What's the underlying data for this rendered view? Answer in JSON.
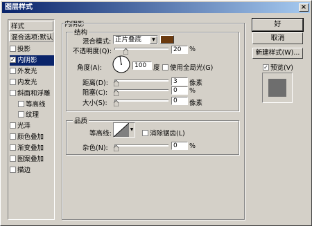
{
  "window": {
    "title": "图层样式",
    "close_glyph": "×"
  },
  "sidebar": {
    "header": "样式",
    "blend_options": "混合选项:默认",
    "items": [
      {
        "label": "投影",
        "checked": false,
        "indent": false,
        "selected": false
      },
      {
        "label": "内阴影",
        "checked": true,
        "indent": false,
        "selected": true
      },
      {
        "label": "外发光",
        "checked": false,
        "indent": false,
        "selected": false
      },
      {
        "label": "内发光",
        "checked": false,
        "indent": false,
        "selected": false
      },
      {
        "label": "斜面和浮雕",
        "checked": false,
        "indent": false,
        "selected": false
      },
      {
        "label": "等高线",
        "checked": false,
        "indent": true,
        "selected": false
      },
      {
        "label": "纹理",
        "checked": false,
        "indent": true,
        "selected": false
      },
      {
        "label": "光泽",
        "checked": false,
        "indent": false,
        "selected": false
      },
      {
        "label": "颜色叠加",
        "checked": false,
        "indent": false,
        "selected": false
      },
      {
        "label": "渐变叠加",
        "checked": false,
        "indent": false,
        "selected": false
      },
      {
        "label": "图案叠加",
        "checked": false,
        "indent": false,
        "selected": false
      },
      {
        "label": "描边",
        "checked": false,
        "indent": false,
        "selected": false
      }
    ]
  },
  "panel": {
    "title": "内阴影",
    "structure": {
      "legend": "结构",
      "blend_mode_label": "混合模式:",
      "blend_mode_value": "正片叠底",
      "blend_color": "#6b3a0f",
      "opacity_label": "不透明度(Q):",
      "opacity_value": "20",
      "opacity_unit": "%",
      "opacity_level": 0.2,
      "angle_label": "角度(A):",
      "angle_value": "100",
      "angle_unit": "度",
      "global_light_label": "使用全局光(G)",
      "distance_label": "距离(D):",
      "distance_value": "3",
      "distance_unit": "像素",
      "choke_label": "阻塞(C):",
      "choke_value": "0",
      "choke_unit": "%",
      "size_label": "大小(S):",
      "size_value": "0",
      "size_unit": "像素"
    },
    "quality": {
      "legend": "品质",
      "contour_label": "等高线:",
      "antialias_label": "消除锯齿(L)",
      "noise_label": "杂色(N):",
      "noise_value": "0",
      "noise_unit": "%"
    }
  },
  "buttons": {
    "ok": "好",
    "cancel": "取消",
    "new_style": "新建样式(W)...",
    "preview_label": "预览(V)",
    "preview_checked": true
  }
}
